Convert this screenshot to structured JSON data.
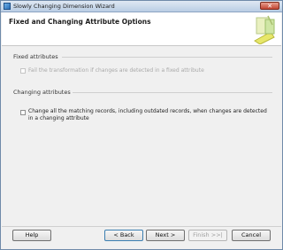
{
  "window": {
    "title": "Slowly Changing Dimension Wizard",
    "close_label": "✕"
  },
  "header": {
    "title": "Fixed and Changing Attribute Options",
    "graphic_icon": "wizard-graphic-icon"
  },
  "fixed_attributes": {
    "section_label": "Fixed attributes",
    "option_label": "Fail the transformation if changes are detected in a fixed attribute",
    "checked": false,
    "enabled": false
  },
  "changing_attributes": {
    "section_label": "Changing attributes",
    "option_label": "Change all the matching records, including outdated records, when changes are detected in a changing attribute",
    "checked": false,
    "enabled": true
  },
  "buttons": {
    "help": "Help",
    "back": "< Back",
    "next": "Next >",
    "finish": "Finish >>|",
    "cancel": "Cancel"
  },
  "colors": {
    "accent": "#3c7fb1",
    "titlebar": "#b9cde4",
    "close": "#c24532"
  }
}
